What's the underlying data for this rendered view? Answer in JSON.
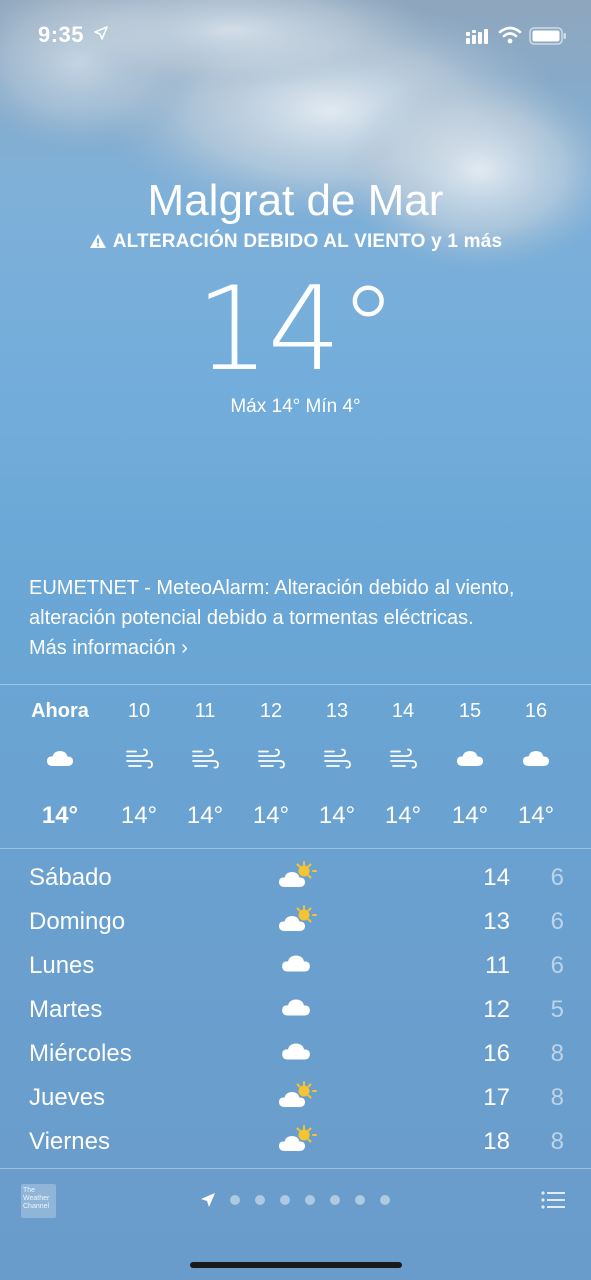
{
  "status_bar": {
    "time": "9:35"
  },
  "location": {
    "city": "Malgrat de Mar",
    "alert": "ALTERACIÓN DEBIDO AL VIENTO y 1 más",
    "current_temp": "14°",
    "hi_lo": "Máx 14° Mín 4°"
  },
  "warning": {
    "text": "EUMETNET - MeteoAlarm: Alteración debido al viento, alteración potencial debido a tormentas eléctricas.",
    "more_link": "Más información",
    "chevron": "›"
  },
  "hourly": [
    {
      "label": "Ahora",
      "icon": "cloud-icon",
      "temp": "14°"
    },
    {
      "label": "10",
      "icon": "wind-icon",
      "temp": "14°"
    },
    {
      "label": "11",
      "icon": "wind-icon",
      "temp": "14°"
    },
    {
      "label": "12",
      "icon": "wind-icon",
      "temp": "14°"
    },
    {
      "label": "13",
      "icon": "wind-icon",
      "temp": "14°"
    },
    {
      "label": "14",
      "icon": "wind-icon",
      "temp": "14°"
    },
    {
      "label": "15",
      "icon": "cloud-icon",
      "temp": "14°"
    },
    {
      "label": "16",
      "icon": "cloud-icon",
      "temp": "14°"
    }
  ],
  "daily": [
    {
      "day": "Sábado",
      "icon": "partly-cloudy-icon",
      "max": "14",
      "min": "6"
    },
    {
      "day": "Domingo",
      "icon": "partly-cloudy-icon",
      "max": "13",
      "min": "6"
    },
    {
      "day": "Lunes",
      "icon": "cloud-icon",
      "max": "11",
      "min": "6"
    },
    {
      "day": "Martes",
      "icon": "cloud-icon",
      "max": "12",
      "min": "5"
    },
    {
      "day": "Miércoles",
      "icon": "cloud-icon",
      "max": "16",
      "min": "8"
    },
    {
      "day": "Jueves",
      "icon": "partly-cloudy-icon",
      "max": "17",
      "min": "8"
    },
    {
      "day": "Viernes",
      "icon": "partly-cloudy-icon",
      "max": "18",
      "min": "8"
    }
  ],
  "footer": {
    "logo_text": "The Weather Channel",
    "page_count": 7
  },
  "colors": {
    "sun": "#f5c431",
    "text": "#ffffff"
  }
}
